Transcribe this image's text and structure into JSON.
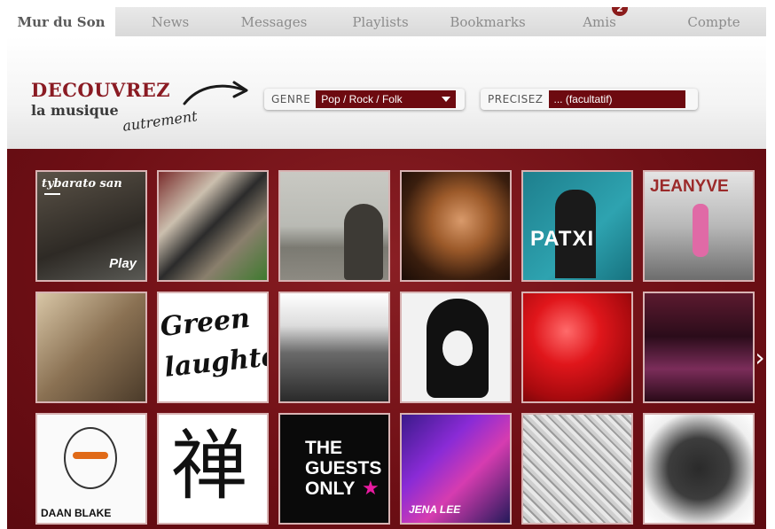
{
  "nav": {
    "tabs": [
      {
        "label": "Mur du Son",
        "active": true
      },
      {
        "label": "News"
      },
      {
        "label": "Messages"
      },
      {
        "label": "Playlists"
      },
      {
        "label": "Bookmarks"
      },
      {
        "label": "Amis",
        "badge": "2"
      },
      {
        "label": "Compte"
      }
    ]
  },
  "hero": {
    "line1": "DECOUVREZ",
    "line2": "la musique",
    "line3": "autrement"
  },
  "filters": {
    "genre_label": "GENRE",
    "genre_value": "Pop / Rock / Folk",
    "precisez_label": "PRECISEZ",
    "precisez_value": "... (facultatif)"
  },
  "tiles": [
    {
      "name": "tybarato-san",
      "text": "tybarato san",
      "sub": "Play"
    },
    {
      "name": "graffiti-wall"
    },
    {
      "name": "seaside-hood"
    },
    {
      "name": "long-hair-portrait"
    },
    {
      "name": "patxi",
      "text": "PATXI"
    },
    {
      "name": "jeanyve",
      "text": "JEANYVE"
    },
    {
      "name": "duo-robot"
    },
    {
      "name": "green-laughter",
      "text": "Green laughter"
    },
    {
      "name": "band-five"
    },
    {
      "name": "black-hair-sketch"
    },
    {
      "name": "red-apple"
    },
    {
      "name": "dj-neon"
    },
    {
      "name": "daan-blake",
      "text": "DAAN BLAKE"
    },
    {
      "name": "zen-kanji",
      "text": "禅"
    },
    {
      "name": "the-guests-only",
      "text": "THE GUESTS ONLY"
    },
    {
      "name": "jena-lee",
      "text": "JENA LEE"
    },
    {
      "name": "sketch-woman"
    },
    {
      "name": "ink-splash"
    }
  ],
  "colors": {
    "accent": "#8a1b23",
    "wall": "#6e0f15",
    "select_bg": "#6d0a10"
  }
}
